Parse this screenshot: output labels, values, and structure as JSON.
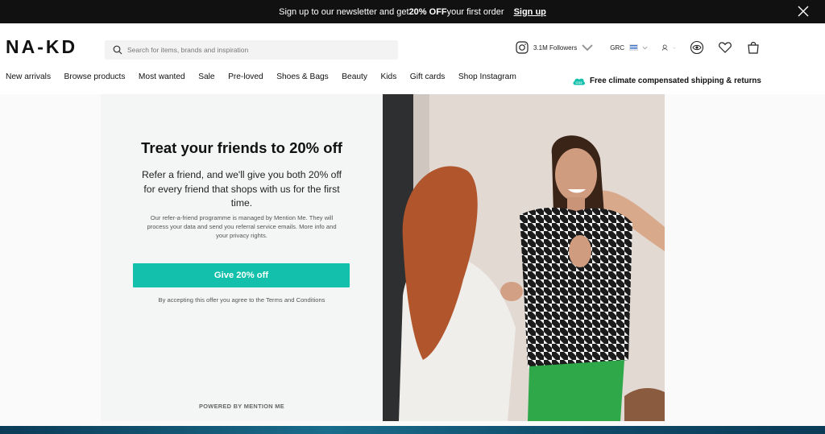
{
  "topbar": {
    "message_pre": "Sign up to our newsletter and get ",
    "message_bold": "20% OFF",
    "message_post": " your first order",
    "signup_label": "Sign up",
    "close_icon": "close-icon"
  },
  "header": {
    "logo": "NA-KD",
    "search_placeholder": "Search for items, brands and inspiration",
    "instagram_followers": "3.1M Followers",
    "country": "GRC",
    "icons": [
      "instagram-icon",
      "account-icon",
      "eye-icon",
      "heart-icon",
      "bag-icon"
    ]
  },
  "nav": {
    "items": [
      "New arrivals",
      "Browse products",
      "Most wanted",
      "Sale",
      "Pre-loved",
      "Shoes & Bags",
      "Beauty",
      "Kids",
      "Gift cards",
      "Shop Instagram"
    ],
    "climate_badge": "CO2",
    "climate_text": "Free climate compensated shipping & returns"
  },
  "promo": {
    "title": "Treat your friends to 20% off",
    "lead": "Refer a friend, and we'll give you both 20% off for every friend that shops with us for the first time.",
    "small": "Our refer-a-friend programme is managed by Mention Me. They will process your data and send you referral service emails. More info and your privacy rights.",
    "cta": "Give 20% off",
    "terms": "By accepting this offer you agree to the Terms and Conditions",
    "powered": "POWERED BY MENTION ME"
  },
  "colors": {
    "accent": "#12c0ab",
    "topbar_bg": "#111111"
  }
}
